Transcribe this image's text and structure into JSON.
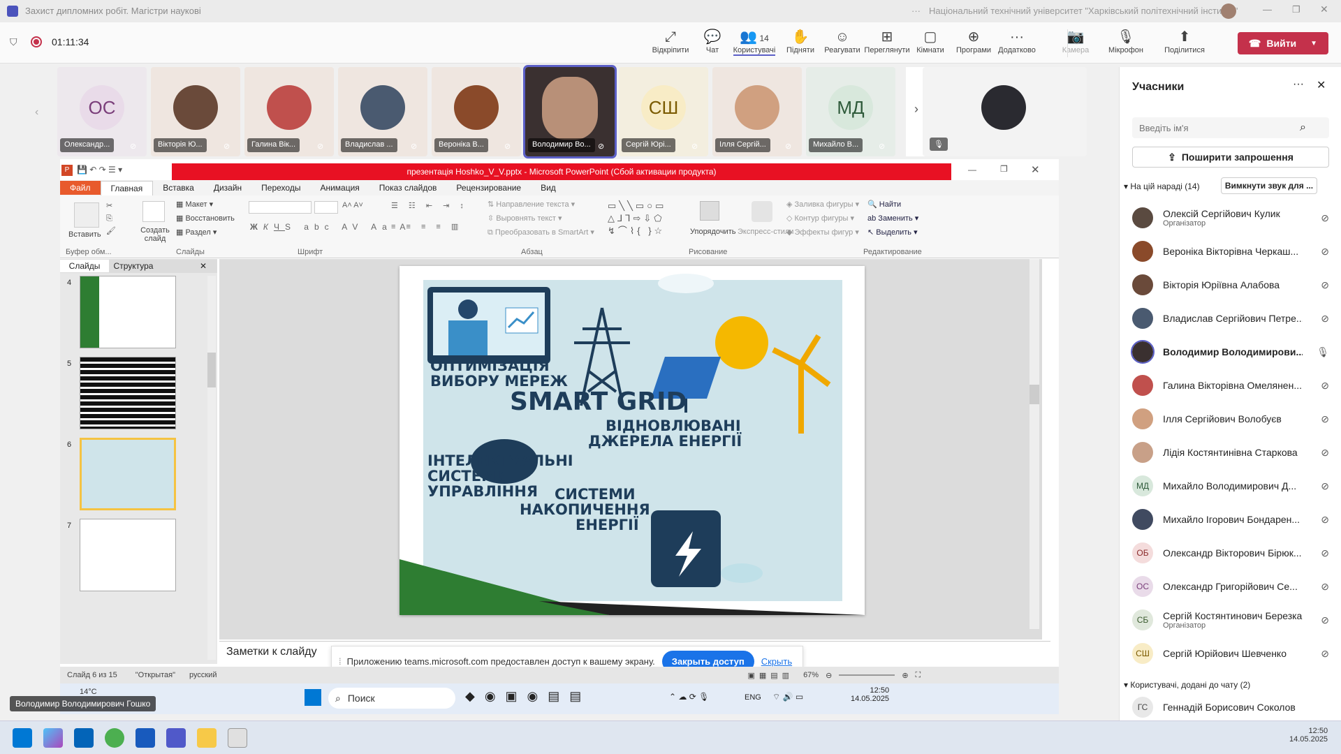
{
  "window": {
    "title": "Захист дипломних робіт. Магістри наукові",
    "org": "Національний технічний університет \"Харківський політехнічний інститут\""
  },
  "meeting": {
    "timer": "01:11:34",
    "leave": "Вийти"
  },
  "toolbar": [
    {
      "label": "Відкріпити",
      "icon": "unpin-icon"
    },
    {
      "label": "Чат",
      "icon": "chat-icon"
    },
    {
      "label": "Користувачі",
      "icon": "people-icon",
      "count": "14"
    },
    {
      "label": "Підняти",
      "icon": "hand-icon"
    },
    {
      "label": "Реагувати",
      "icon": "smile-icon"
    },
    {
      "label": "Переглянути",
      "icon": "grid-icon"
    },
    {
      "label": "Кімнати",
      "icon": "rooms-icon"
    },
    {
      "label": "Програми",
      "icon": "apps-icon"
    },
    {
      "label": "Додатково",
      "icon": "more-icon"
    },
    {
      "label": "Камера",
      "icon": "camera-off-icon"
    },
    {
      "label": "Мікрофон",
      "icon": "mic-off-icon"
    },
    {
      "label": "Поділитися",
      "icon": "share-icon"
    }
  ],
  "tiles": [
    {
      "name": "Олександр...",
      "initials": "ОС",
      "bg": "#e9dbe9",
      "fg": "#7a3e7a"
    },
    {
      "name": "Вікторія Ю...",
      "photo": "#6a4a3a"
    },
    {
      "name": "Галина Вік...",
      "photo": "#c0504d"
    },
    {
      "name": "Владислав ...",
      "photo": "#4a5a70"
    },
    {
      "name": "Вероніка В...",
      "photo": "#8a4a2a"
    },
    {
      "name": "Володимир Во...",
      "photo": "#3a3030"
    },
    {
      "name": "Сергій Юрі...",
      "initials": "СШ",
      "bg": "#f8ecc6",
      "fg": "#7a5a00"
    },
    {
      "name": "Ілля Сергій...",
      "photo": "#d0a080"
    },
    {
      "name": "Михайло В...",
      "initials": "МД",
      "bg": "#d8e8dc",
      "fg": "#2e5a3a"
    }
  ],
  "ppt": {
    "title": "презентація Hoshko_V_V.pptx  -  Microsoft PowerPoint (Сбой активации продукта)",
    "tabs": [
      "Файл",
      "Главная",
      "Вставка",
      "Дизайн",
      "Переходы",
      "Анимация",
      "Показ слайдов",
      "Рецензирование",
      "Вид"
    ],
    "ribbon": {
      "paste": "Вставить",
      "clipboard": "Буфер обм...",
      "new_slide": "Создать слайд",
      "layout": "Макет",
      "reset": "Восстановить",
      "section": "Раздел",
      "slides_group": "Слайды",
      "font_group": "Шрифт",
      "para_group": "Абзац",
      "text_dir": "Направление текста",
      "align_text": "Выровнять текст",
      "smartart": "Преобразовать в SmartArt",
      "arrange": "Упорядочить",
      "quick_styles": "Экспресс-стили",
      "fill": "Заливка фигуры",
      "outline": "Контур фигуры",
      "effects": "Эффекты фигур",
      "drawing_group": "Рисование",
      "find": "Найти",
      "replace": "Заменить",
      "select": "Выделить",
      "editing_group": "Редактирование"
    },
    "panel_tabs": [
      "Слайды",
      "Структура"
    ],
    "thumbs": [
      "4",
      "5",
      "6",
      "7"
    ],
    "slide_text": {
      "t1": "ОПТИМІЗАЦІЯ",
      "t2": "ВИБОРУ МЕРЕЖ",
      "t3": "SMART GRID",
      "t4": "ВІДНОВЛЮВАНІ",
      "t5": "ДЖЕРЕЛА ЕНЕРГІЇ",
      "t6": "ІНТЕЛЕКТУАЛЬНІ",
      "t7": "СИСТЕМИ",
      "t8": "УПРАВЛІННЯ",
      "t9": "СИСТЕМИ",
      "t10": "НАКОПИЧЕННЯ",
      "t11": "ЕНЕРГІЇ"
    },
    "notes": "Заметки к слайду",
    "status": {
      "slide": "Слайд 6 из 15",
      "theme": "\"Открытая\"",
      "lang": "русский",
      "zoom": "67%"
    }
  },
  "share_banner": {
    "text": "Приложению teams.microsoft.com предоставлен доступ к вашему экрану.",
    "stop": "Закрыть доступ",
    "hide": "Скрыть"
  },
  "inner_taskbar": {
    "search": "Поиск",
    "lang": "ENG",
    "time": "12:50",
    "date": "14.05.2025",
    "weather": "14°C"
  },
  "presenter": "Володимир Володимирович Гошко",
  "panel": {
    "title": "Учасники",
    "search_placeholder": "Введіть ім'я",
    "invite": "Поширити запрошення",
    "section1": "На цій нараді (14)",
    "mute_all": "Вимкнути звук для ...",
    "section2": "Користувачі, додані до чату (2)",
    "people": [
      {
        "name": "Олексій Сергійович Кулик",
        "sub": "Організатор",
        "photo": "#5a4a40"
      },
      {
        "name": "Вероніка Вікторівна Черкаш...",
        "photo": "#8a4a2a"
      },
      {
        "name": "Вікторія Юріївна Алабова",
        "photo": "#6a4a3a"
      },
      {
        "name": "Владислав Сергійович Петре...",
        "photo": "#4a5a70"
      },
      {
        "name": "Володимир Володимирови...",
        "photo": "#3a3030",
        "bold": true
      },
      {
        "name": "Галина Вікторівна Омелянен...",
        "photo": "#c0504d"
      },
      {
        "name": "Ілля Сергійович Волобуєв",
        "photo": "#d0a080"
      },
      {
        "name": "Лідія Костянтинівна Старкова",
        "photo": "#c8a088"
      },
      {
        "name": "Михайло Володимирович Д...",
        "initials": "МД",
        "bg": "#d8e8dc",
        "fg": "#2e5a3a"
      },
      {
        "name": "Михайло Ігорович Бондарен...",
        "photo": "#404a60"
      },
      {
        "name": "Олександр Вікторович Бірюк...",
        "initials": "ОБ",
        "bg": "#f4dcdc",
        "fg": "#8a2a2a"
      },
      {
        "name": "Олександр Григорійович Се...",
        "initials": "ОС",
        "bg": "#e9dbe9",
        "fg": "#7a3e7a"
      },
      {
        "name": "Сергій Костянтинович Березка",
        "sub": "Організатор",
        "initials": "СБ",
        "bg": "#e0e8dc",
        "fg": "#3a5a2e"
      },
      {
        "name": "Сергій Юрійович Шевченко",
        "initials": "СШ",
        "bg": "#f8ecc6",
        "fg": "#7a5a00"
      }
    ],
    "chat_people": [
      {
        "name": "Геннадій Борисович Соколов",
        "initials": "ГС",
        "bg": "#e8e8e8",
        "fg": "#444"
      }
    ]
  },
  "taskbar": {
    "time": "12:50",
    "date": "14.05.2025"
  }
}
